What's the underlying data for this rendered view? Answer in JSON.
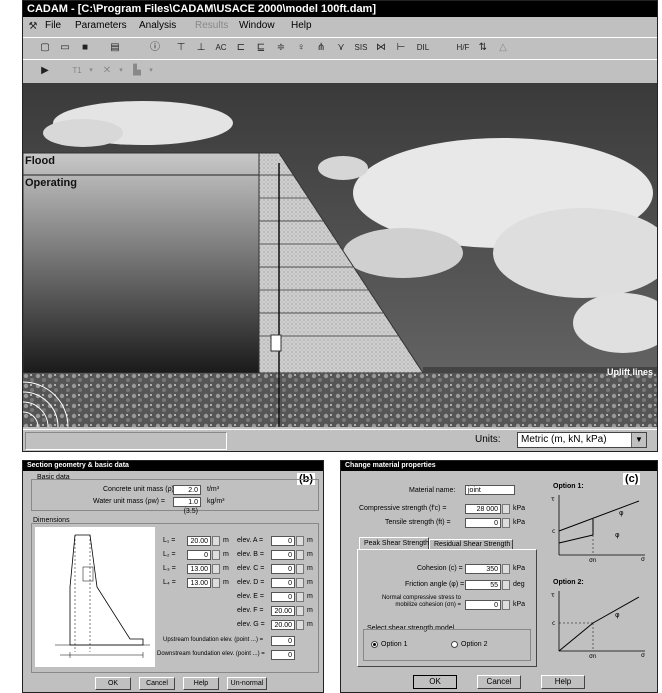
{
  "main_window": {
    "title": "CADAM - [C:\\Program Files\\CADAM\\USACE 2000\\model 100ft.dam]",
    "tag": "(a)",
    "menu": [
      "File",
      "Parameters",
      "Analysis",
      "Results",
      "Window",
      "Help"
    ],
    "reservoir_labels": {
      "flood": "Flood",
      "operating": "Operating"
    },
    "uplift_label": "Uplift lines",
    "units_label": "Units:",
    "units_value": "Metric (m, kN, kPa)",
    "toolbar_text": {
      "ac": "AC",
      "sis": "SIS",
      "dil": "DIL",
      "hf": "H/F",
      "t1": "T1"
    }
  },
  "section_dialog": {
    "title": "Section geometry & basic data",
    "tag": "(b)",
    "basic_data_label": "Basic data",
    "concrete_label": "Concrete unit mass (ρ) =",
    "concrete_value": "2.0",
    "concrete_unit": "t/m³",
    "water_label": "Water unit mass (ρw) =",
    "water_value": "1.0 (3.5)",
    "water_unit": "kg/m³",
    "dimensions_label": "Dimensions",
    "left_fields": [
      {
        "label": "L₁ =",
        "value": "20.00",
        "unit": "m"
      },
      {
        "label": "L₂ =",
        "value": "0",
        "unit": "m"
      },
      {
        "label": "L₃ =",
        "value": "13.00",
        "unit": "m"
      },
      {
        "label": "L₄ =",
        "value": "13.00",
        "unit": "m"
      }
    ],
    "right_fields": [
      {
        "label": "elev. A =",
        "value": "0",
        "unit": "m"
      },
      {
        "label": "elev. B =",
        "value": "0",
        "unit": "m"
      },
      {
        "label": "elev. C =",
        "value": "0",
        "unit": "m"
      },
      {
        "label": "elev. D =",
        "value": "0",
        "unit": "m"
      },
      {
        "label": "elev. E =",
        "value": "0",
        "unit": "m"
      },
      {
        "label": "elev. F =",
        "value": "20.00",
        "unit": "m"
      },
      {
        "label": "elev. G =",
        "value": "20.00",
        "unit": "m"
      }
    ],
    "upstream_label": "Upstream foundation elev. (point ...) =",
    "upstream_value": "0",
    "downstream_label": "Downstream foundation elev. (point ...) =",
    "downstream_value": "0",
    "buttons": [
      "OK",
      "Cancel",
      "Help",
      "Un-normal"
    ]
  },
  "material_dialog": {
    "title": "Change material properties",
    "tag": "(c)",
    "name_label": "Material name:",
    "name_value": "joint",
    "compressive_label": "Compressive strength (f'c) =",
    "compressive_value": "28 000",
    "tensile_label": "Tensile strength (ft) =",
    "tensile_value": "0",
    "unit_kpa": "kPa",
    "tab_peak": "Peak Shear Strength",
    "tab_residual": "Residual Shear Strength",
    "cohesion_label": "Cohesion (c) =",
    "cohesion_value": "350",
    "friction_label": "Friction angle (φ) =",
    "friction_value": "55",
    "friction_unit": "deg",
    "normal_label": "Normal compressive stress to mobilize cohesion (σn) =",
    "normal_value": "0",
    "model_label": "Select shear strength model",
    "option1": "Option 1",
    "option2": "Option 2",
    "option1_graph_title": "Option 1:",
    "option2_graph_title": "Option 2:",
    "buttons": [
      "OK",
      "Cancel",
      "Help"
    ]
  }
}
